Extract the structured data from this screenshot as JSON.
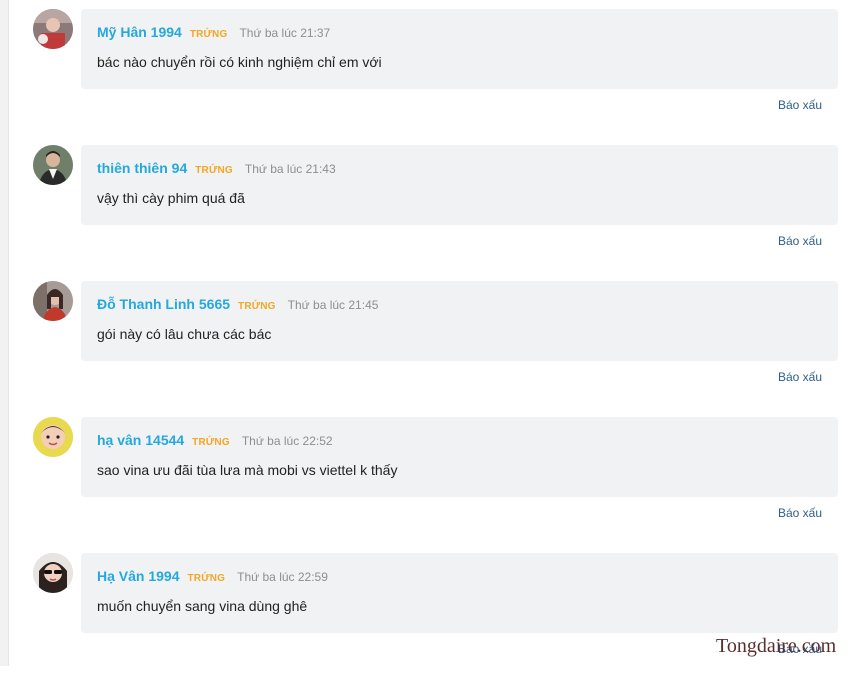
{
  "comments": [
    {
      "user": "Mỹ Hân 1994",
      "rank": "TRỨNG",
      "time": "Thứ ba lúc 21:37",
      "text": "bác nào chuyển rồi có kinh nghiệm chỉ em với",
      "report": "Báo xấu"
    },
    {
      "user": "thiên thiên 94",
      "rank": "TRỨNG",
      "time": "Thứ ba lúc 21:43",
      "text": "vậy thì cày phim quá đã",
      "report": "Báo xấu"
    },
    {
      "user": "Đỗ Thanh Linh 5665",
      "rank": "TRỨNG",
      "time": "Thứ ba lúc 21:45",
      "text": "gói này có lâu chưa các bác",
      "report": "Báo xấu"
    },
    {
      "user": "hạ vân 14544",
      "rank": "TRỨNG",
      "time": "Thứ ba lúc 22:52",
      "text": "sao vina ưu đãi tùa lưa mà mobi vs viettel k thấy",
      "report": "Báo xấu"
    },
    {
      "user": "Hạ Vân 1994",
      "rank": "TRỨNG",
      "time": "Thứ ba lúc 22:59",
      "text": "muốn chuyển sang vina dùng ghê",
      "report": "Báo xấu"
    }
  ],
  "watermark": "Tongdaire.com",
  "colors": {
    "username": "#24a8de",
    "rank": "#f5a623",
    "time": "#8e8e8e",
    "report": "#2e5f8a",
    "bubble": "#f1f2f3"
  }
}
